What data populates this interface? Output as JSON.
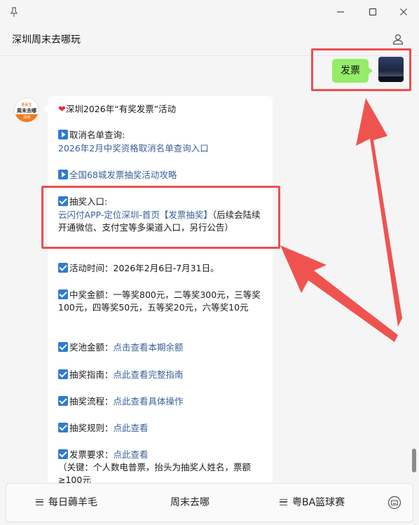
{
  "header": {
    "title": "深圳周末去哪玩"
  },
  "my_message": {
    "text": "发票"
  },
  "bot_avatar": {
    "line1": "惠民生",
    "line2": "周末去哪",
    "line3": "深圳"
  },
  "message": {
    "headline": "深圳2026年“有奖发票”活动",
    "cancel_label": "取消名单查询:",
    "cancel_link": "2026年2月中奖资格取消名单查询入口",
    "guide_link": "全国68城发票抽奖活动攻略",
    "entry_label": "抽奖入口:",
    "entry_link": "云闪付APP-定位深圳-首页【发票抽奖】",
    "entry_note": "（后续会陆续开通微信、支付宝等多渠道入口，另行公告）",
    "time_text": "活动时间：2026年2月6日-7月31日。",
    "amount_text": "中奖金额：一等奖800元，二等奖300元，三等奖100元，四等奖50元，五等奖20元，六等奖10元",
    "pool_label": "奖池金额：",
    "pool_link": "点击查看本期余额",
    "guide2_label": "抽奖指南：",
    "guide2_link": "点此查看完整指南",
    "process_label": "抽奖流程：",
    "process_link": "点此查看具体操作",
    "rules_label": "抽奖规则：",
    "rules_link": "点此查看",
    "invoice_label": "发票要求：",
    "invoice_link": "点此查看",
    "invoice_note": "（关键：个人数电普票，抬头为抽奖人姓名，票额≥100元"
  },
  "bottom_menu": [
    "每日薅羊毛",
    "周末去哪",
    "粤BA篮球赛"
  ],
  "colors": {
    "accent": "#2f7bd1",
    "link": "#3a5f9c",
    "highlight": "#ef4d4f",
    "sent_bubble": "#95ec69"
  }
}
